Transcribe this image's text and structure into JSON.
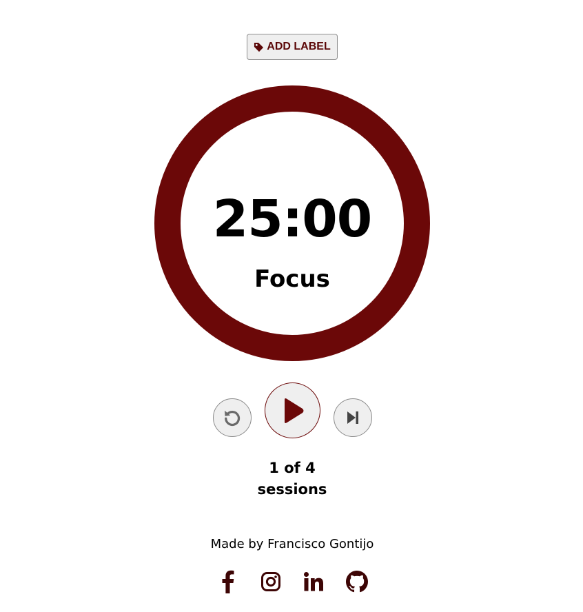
{
  "colors": {
    "accent": "#6b0808",
    "button_bg": "#efefef",
    "button_border": "#8a8a8a",
    "text": "#000000",
    "icon_gray": "#666666",
    "icon_dark": "#444444"
  },
  "label_button": {
    "icon": "tag-icon",
    "text": "ADD LABEL"
  },
  "timer": {
    "time": "25:00",
    "mode": "Focus"
  },
  "controls": {
    "reset_icon": "reset-icon",
    "play_icon": "play-icon",
    "skip_icon": "skip-icon"
  },
  "sessions": {
    "line1": "1 of 4",
    "line2": "sessions"
  },
  "footer": {
    "credit": "Made by Francisco Gontijo",
    "social": [
      "facebook-icon",
      "instagram-icon",
      "linkedin-icon",
      "github-icon"
    ]
  }
}
